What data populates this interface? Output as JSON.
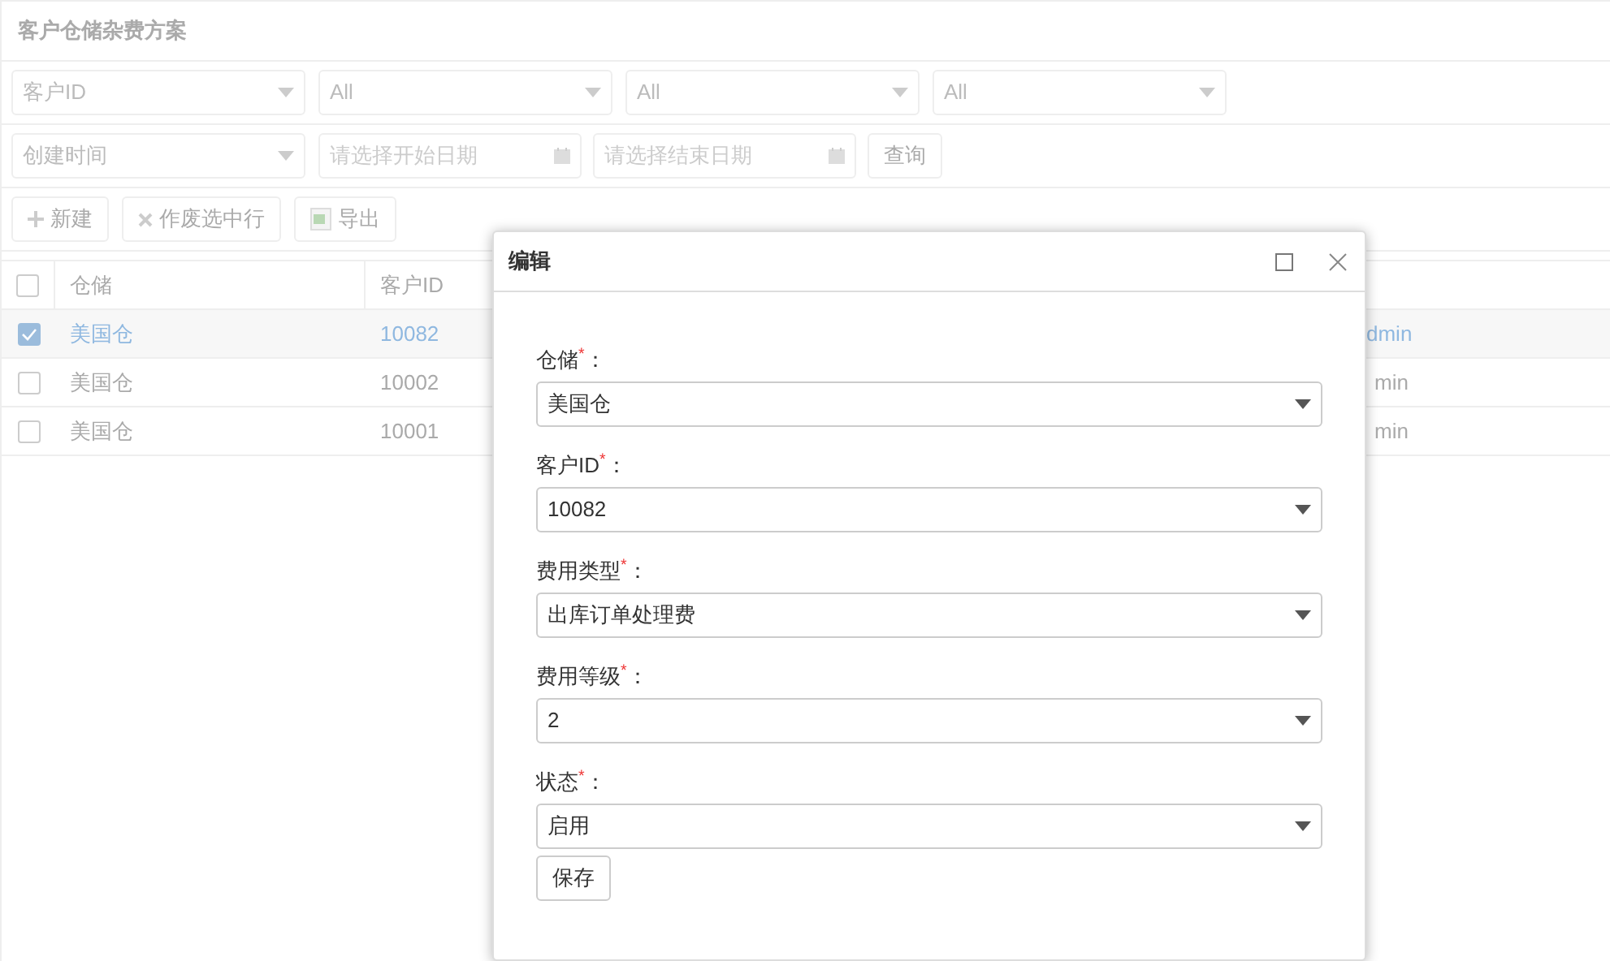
{
  "page_title": "客户仓储杂费方案",
  "filters_row1": [
    {
      "value": "客户ID"
    },
    {
      "value": "All"
    },
    {
      "value": "All"
    },
    {
      "value": "All"
    }
  ],
  "filters_row2": {
    "field": "创建时间",
    "start_placeholder": "请选择开始日期",
    "end_placeholder": "请选择结束日期",
    "query_button": "查询"
  },
  "toolbar": [
    {
      "kind": "add",
      "label": "新建"
    },
    {
      "kind": "void",
      "label": "作废选中行"
    },
    {
      "kind": "export",
      "label": "导出"
    }
  ],
  "table": {
    "select_all": {
      "checked": false
    },
    "columns": [
      "仓储",
      "客户ID"
    ],
    "rows": [
      {
        "selected": true,
        "cells": [
          "美国仓",
          "10082"
        ],
        "column_3": "dmin"
      },
      {
        "selected": false,
        "cells": [
          "美国仓",
          "10002"
        ],
        "column_3": "min"
      },
      {
        "selected": false,
        "cells": [
          "美国仓",
          "10001"
        ],
        "column_3": "min"
      }
    ]
  },
  "dialog": {
    "title": "编辑",
    "fields": [
      {
        "label": "仓储$^{*}$：",
        "value": "美国仓"
      },
      {
        "label": "客户ID$^{*}$：",
        "value": "10082"
      },
      {
        "label": "费用类型$^{*}$：",
        "value": "出库订单处理费"
      },
      {
        "label": "费用等级$^{*}$：",
        "value": "2"
      },
      {
        "label": "状态$^{*}$：",
        "value": "启用"
      }
    ],
    "save_button": "保存"
  }
}
